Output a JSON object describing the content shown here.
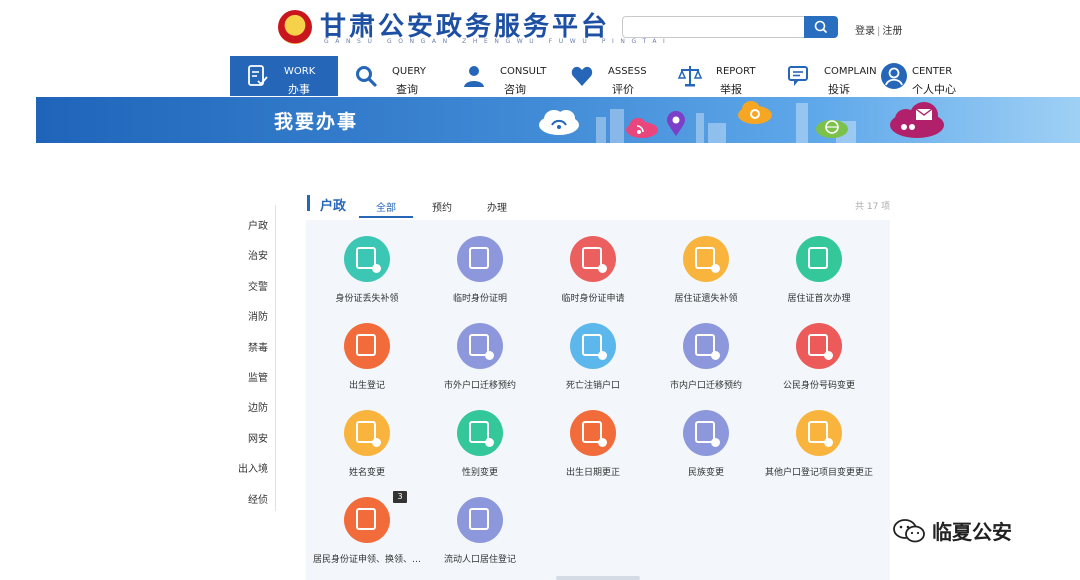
{
  "header": {
    "site_title": "甘肃公安政务服务平台",
    "site_subtitle": "GANSU GONGAN ZHENGWU FUWU PINGTAI",
    "search_placeholder": "",
    "login": "登录",
    "separator": "|",
    "register": "注册"
  },
  "nav": [
    {
      "en": "WORK",
      "cn": "办事",
      "icon": "work-icon",
      "active": true
    },
    {
      "en": "QUERY",
      "cn": "查询",
      "icon": "search-icon"
    },
    {
      "en": "CONSULT",
      "cn": "咨询",
      "icon": "person-icon"
    },
    {
      "en": "ASSESS",
      "cn": "评价",
      "icon": "heart-icon"
    },
    {
      "en": "REPORT",
      "cn": "举报",
      "icon": "scales-icon"
    },
    {
      "en": "COMPLAIN",
      "cn": "投诉",
      "icon": "chat-icon"
    },
    {
      "en": "CENTER",
      "cn": "个人中心",
      "icon": "user-circle-icon"
    }
  ],
  "banner": {
    "title": "我要办事"
  },
  "sidebar": {
    "items": [
      "户政",
      "治安",
      "交警",
      "消防",
      "禁毒",
      "监管",
      "边防",
      "网安",
      "出入境",
      "经侦"
    ]
  },
  "section": {
    "title": "户政",
    "tabs": [
      "全部",
      "预约",
      "办理"
    ],
    "active_tab": "全部",
    "count_text": "共 17 项"
  },
  "services": [
    {
      "label": "身份证丢失补领",
      "color": "#3cc7b4"
    },
    {
      "label": "临时身份证明",
      "color": "#8d98dc"
    },
    {
      "label": "临时身份证申请",
      "color": "#ec5f5f"
    },
    {
      "label": "居住证遗失补领",
      "color": "#f8b43c"
    },
    {
      "label": "居住证首次办理",
      "color": "#33c79a"
    },
    {
      "label": "出生登记",
      "color": "#f26b3a"
    },
    {
      "label": "市外户口迁移预约",
      "color": "#8d98dc"
    },
    {
      "label": "死亡注销户口",
      "color": "#5cb8ec"
    },
    {
      "label": "市内户口迁移预约",
      "color": "#8d98dc"
    },
    {
      "label": "公民身份号码变更",
      "color": "#ec5a5a"
    },
    {
      "label": "姓名变更",
      "color": "#f8b43c"
    },
    {
      "label": "性别变更",
      "color": "#33c79a"
    },
    {
      "label": "出生日期更正",
      "color": "#f26b3a"
    },
    {
      "label": "民族变更",
      "color": "#8d98dc"
    },
    {
      "label": "其他户口登记项目变更更正",
      "color": "#f8b43c"
    },
    {
      "label": "居民身份证申领、换领、…",
      "color": "#f26b3a",
      "badge": "3"
    },
    {
      "label": "流动人口居住登记",
      "color": "#8d98dc"
    }
  ],
  "watermark": {
    "text": "临夏公安"
  },
  "colors": {
    "primary": "#2566b8",
    "banner": "#3e88d4"
  }
}
